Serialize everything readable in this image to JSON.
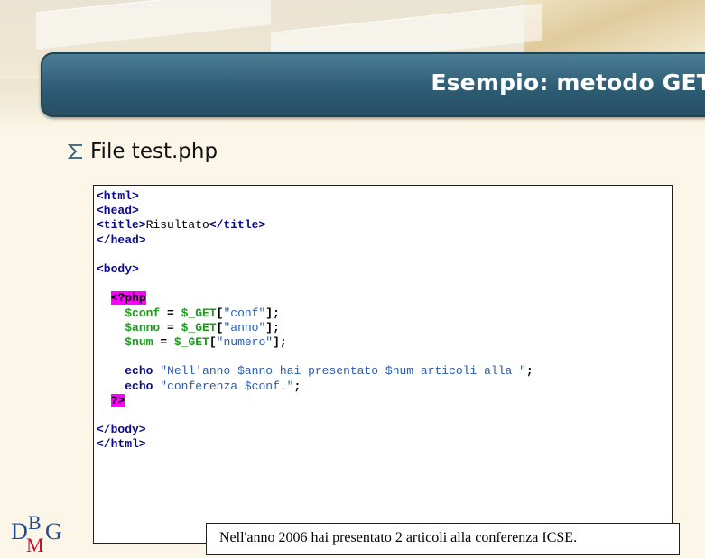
{
  "slide": {
    "title": "Esempio: metodo GET",
    "bullet": "File test.php"
  },
  "code": {
    "line1": "<html>",
    "line2": "<head>",
    "line3_open": "<title>",
    "line3_text": "Risultato",
    "line3_close": "</title>",
    "line4": "</head>",
    "line5": "<body>",
    "php_open": "<?php",
    "l8_var": "$conf",
    "l8_get": "$_GET",
    "l8_key": "\"conf\"",
    "l9_var": "$anno",
    "l9_get": "$_GET",
    "l9_key": "\"anno\"",
    "l10_var": "$num",
    "l10_get": "$_GET",
    "l10_key": "\"numero\"",
    "echo1": "echo",
    "echo1_str": "\"Nell'anno $anno hai presentato $num articoli alla \"",
    "echo2": "echo",
    "echo2_str": "\"conferenza $conf.\"",
    "php_close": "?>",
    "body_close": "</body>",
    "html_close": "</html>"
  },
  "output": "Nell'anno 2006 hai presentato 2 articoli alla conferenza ICSE.",
  "logo": {
    "text": "DBMG",
    "d": "D",
    "b": "B",
    "m": "M",
    "g": "G"
  },
  "colors": {
    "title_bar": "#2e5d74",
    "php_highlight": "#ff00ff",
    "variable": "#1c9a1c",
    "string": "#2a5bb0",
    "tag": "#0a0a8a",
    "logo_blue": "#1f4a9c",
    "logo_red": "#c8102e"
  }
}
